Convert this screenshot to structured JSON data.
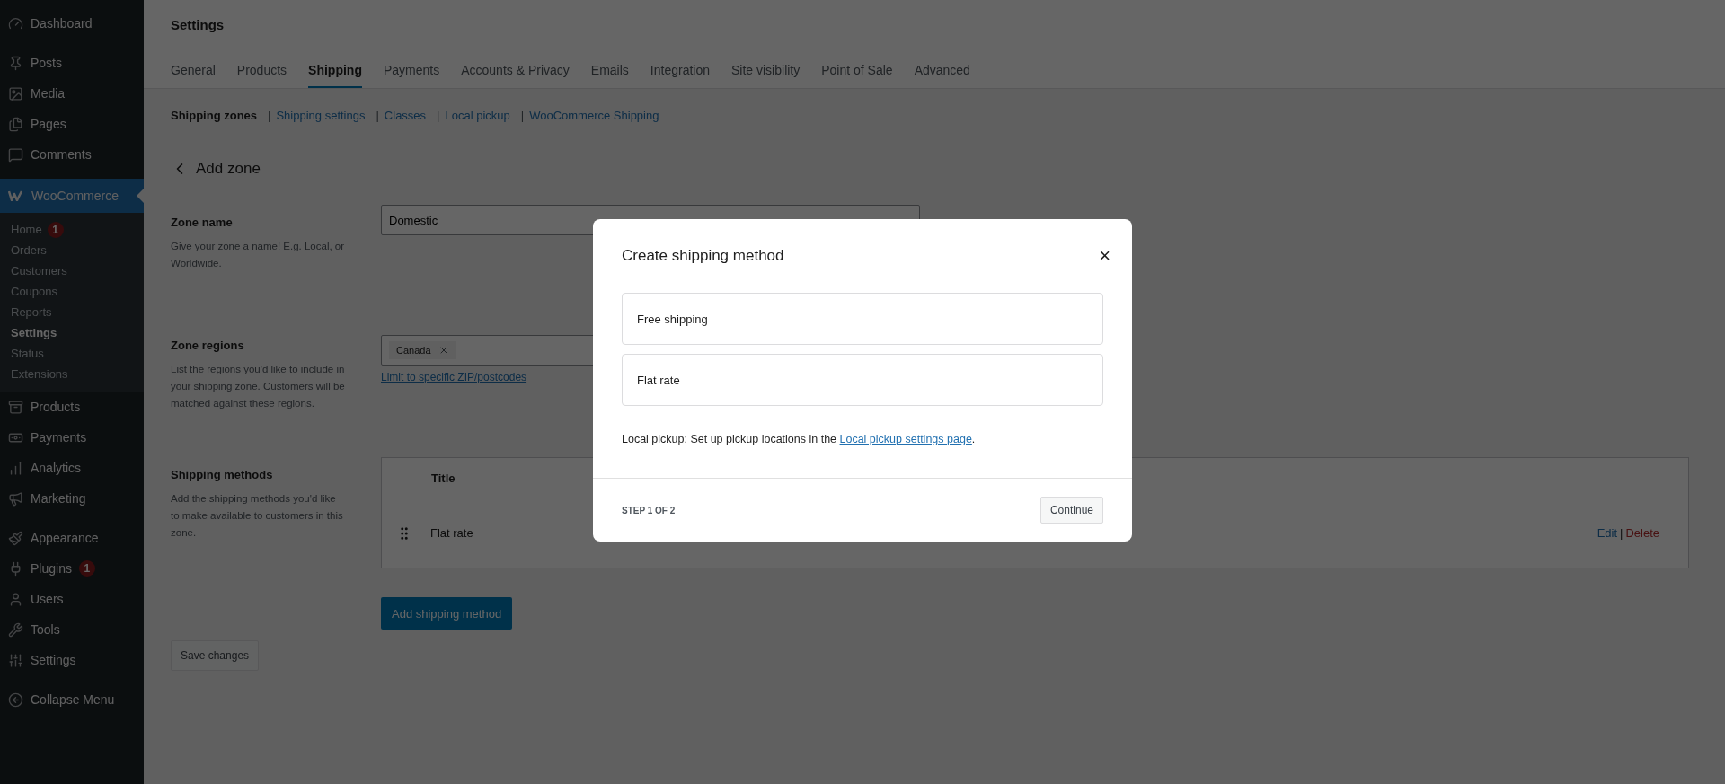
{
  "sidebar": {
    "groups": [
      {
        "items": [
          {
            "label": "Dashboard",
            "selected": false
          }
        ]
      },
      {
        "items": [
          {
            "label": "Posts",
            "selected": false
          },
          {
            "label": "Media",
            "selected": false
          },
          {
            "label": "Pages",
            "selected": false
          },
          {
            "label": "Comments",
            "selected": false
          }
        ]
      },
      {
        "items": [
          {
            "label": "WooCommerce",
            "selected": true,
            "children": [
              {
                "label": "Home",
                "badge": "1",
                "selected": false
              },
              {
                "label": "Orders",
                "selected": false
              },
              {
                "label": "Customers",
                "selected": false
              },
              {
                "label": "Coupons",
                "selected": false
              },
              {
                "label": "Reports",
                "selected": false
              },
              {
                "label": "Settings",
                "selected": true
              },
              {
                "label": "Status",
                "selected": false
              },
              {
                "label": "Extensions",
                "selected": false
              }
            ]
          },
          {
            "label": "Products",
            "selected": false
          },
          {
            "label": "Payments",
            "selected": false
          },
          {
            "label": "Analytics",
            "selected": false
          },
          {
            "label": "Marketing",
            "selected": false
          }
        ]
      },
      {
        "items": [
          {
            "label": "Appearance",
            "selected": false
          },
          {
            "label": "Plugins",
            "badge": "1",
            "selected": false
          },
          {
            "label": "Users",
            "selected": false
          },
          {
            "label": "Tools",
            "selected": false
          },
          {
            "label": "Settings",
            "selected": false
          }
        ]
      },
      {
        "items": [
          {
            "label": "Collapse Menu",
            "selected": false
          }
        ]
      }
    ]
  },
  "header": {
    "title": "Settings",
    "tabs": [
      {
        "label": "General",
        "selected": false
      },
      {
        "label": "Products",
        "selected": false
      },
      {
        "label": "Shipping",
        "selected": true
      },
      {
        "label": "Payments",
        "selected": false
      },
      {
        "label": "Accounts & Privacy",
        "selected": false
      },
      {
        "label": "Emails",
        "selected": false
      },
      {
        "label": "Integration",
        "selected": false
      },
      {
        "label": "Site visibility",
        "selected": false
      },
      {
        "label": "Point of Sale",
        "selected": false
      },
      {
        "label": "Advanced",
        "selected": false
      }
    ]
  },
  "subnav": {
    "separator": "|",
    "links": [
      {
        "label": "Shipping zones",
        "selected": true
      },
      {
        "label": "Shipping settings",
        "selected": false
      },
      {
        "label": "Classes",
        "selected": false
      },
      {
        "label": "Local pickup",
        "selected": false
      },
      {
        "label": "WooCommerce Shipping",
        "selected": false
      }
    ]
  },
  "page_title": "Add zone",
  "zone_name": {
    "label": "Zone name",
    "description": "Give your zone a name! E.g. Local, or Worldwide.",
    "value": "Domestic"
  },
  "zone_regions": {
    "label": "Zone regions",
    "description": "List the regions you'd like to include in your shipping zone. Customers will be matched against these regions.",
    "tags": [
      "Canada"
    ],
    "link": "Limit to specific ZIP/postcodes"
  },
  "shipping_methods": {
    "label": "Shipping methods",
    "description": "Add the shipping methods you'd like to make available to customers in this zone.",
    "columns": [
      "Title"
    ],
    "rows": [
      {
        "title": "Flat rate",
        "edit": "Edit",
        "separator": "|",
        "delete": "Delete"
      }
    ],
    "add_button": "Add shipping method"
  },
  "save_button": {
    "label": "Save changes",
    "disabled": true
  },
  "modal": {
    "title": "Create shipping method",
    "close": "×",
    "options": [
      {
        "label": "Free shipping",
        "selected": false
      },
      {
        "label": "Flat rate",
        "selected": false
      }
    ],
    "note": "Local pickup: Set up pickup locations in the ",
    "note_link": "Local pickup settings page",
    "note_end": ".",
    "step": "STEP 1 OF 2",
    "continue": {
      "label": "Continue",
      "disabled": true
    }
  }
}
